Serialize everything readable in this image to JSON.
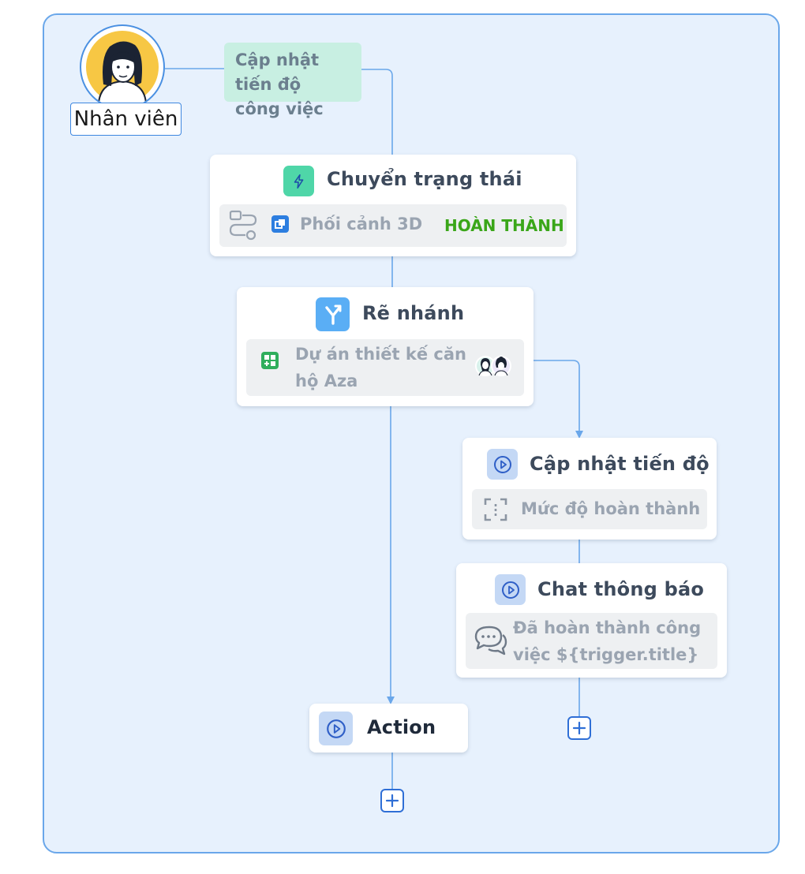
{
  "actor": {
    "label": "Nhân viên"
  },
  "trigger": {
    "label": "Cập nhật tiến độ công việc"
  },
  "nodes": {
    "status_change": {
      "title": "Chuyển trạng thái",
      "icon": "lightning-icon",
      "detail_text": "Phối cảnh 3D",
      "status": "HOÀN THÀNH"
    },
    "branch": {
      "title": "Rẽ nhánh",
      "icon": "branch-icon",
      "detail_text": "Dự án thiết kế căn hộ Aza"
    },
    "update_progress": {
      "title": "Cập nhật tiến độ",
      "icon": "play-icon",
      "detail_text": "Mức độ hoàn thành"
    },
    "chat_notify": {
      "title": "Chat thông báo",
      "icon": "play-icon",
      "detail_text": "Đã hoàn thành công việc ${trigger.title}"
    },
    "action": {
      "title": "Action",
      "icon": "play-icon"
    }
  },
  "colors": {
    "canvas_bg": "#e7f1fd",
    "canvas_border": "#6aa7ea",
    "trigger_bg": "#c8efe2",
    "status_green": "#3aa619",
    "connector": "#6aa7ea"
  }
}
